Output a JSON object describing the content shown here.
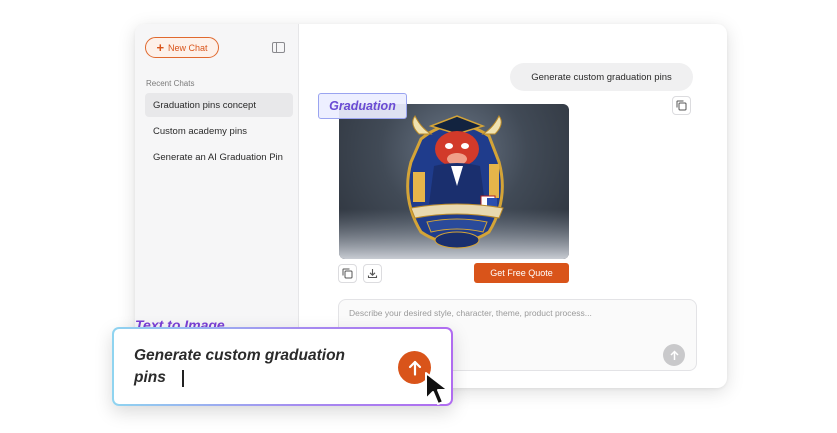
{
  "sidebar": {
    "new_chat_label": "New Chat",
    "recent_title": "Recent Chats",
    "items": [
      {
        "label": "Graduation pins concept"
      },
      {
        "label": "Custom academy pins"
      },
      {
        "label": "Generate an AI Graduation Pin"
      }
    ]
  },
  "conversation": {
    "user_message": "Generate custom graduation pins",
    "image_tag": "Graduation",
    "quote_button": "Get Free Quote"
  },
  "composer": {
    "placeholder": "Describe your desired style, character, theme, product process..."
  },
  "overlay": {
    "label": "Text to Image",
    "prompt_text": "Generate custom graduation pins"
  },
  "colors": {
    "accent": "#d9541a",
    "tag_purple": "#6a4bd4",
    "gradient_start": "#8fd4f0",
    "gradient_end": "#b06cf0"
  },
  "icons": [
    "plus-icon",
    "sidebar-toggle-icon",
    "copy-icon",
    "download-icon",
    "arrow-up-icon",
    "mouse-pointer-icon"
  ]
}
